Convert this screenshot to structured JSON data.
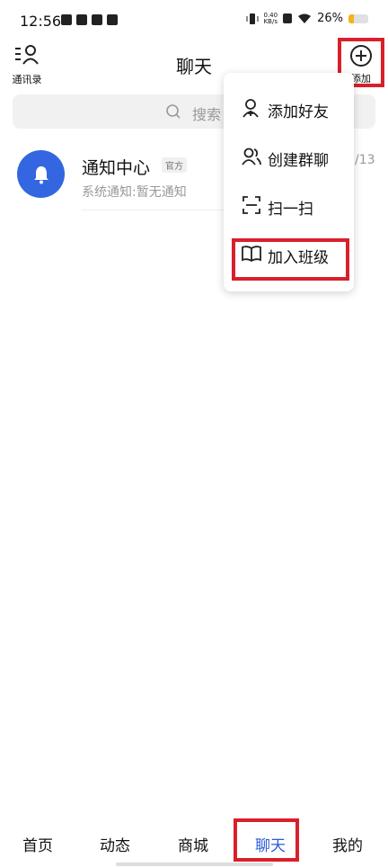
{
  "status_bar": {
    "time": "12:56",
    "net_speed_value": "0.40",
    "net_speed_unit": "KB/s",
    "battery_percent": "26%",
    "battery_level": 0.26
  },
  "header": {
    "contacts_label": "通讯录",
    "title": "聊天",
    "add_label": "添加"
  },
  "search": {
    "placeholder": "搜索"
  },
  "conversations": [
    {
      "name": "通知中心",
      "badge": "官方",
      "preview": "系统通知:暂无通知",
      "time": "/13"
    }
  ],
  "add_menu": {
    "items": [
      {
        "label": "添加好友",
        "icon": "add-friend-icon"
      },
      {
        "label": "创建群聊",
        "icon": "create-group-icon"
      },
      {
        "label": "扫一扫",
        "icon": "scan-icon"
      },
      {
        "label": "加入班级",
        "icon": "open-book-icon"
      }
    ]
  },
  "tabs": [
    "首页",
    "动态",
    "商城",
    "聊天",
    "我的"
  ],
  "active_tab": "聊天",
  "colors": {
    "accent_blue": "#2a5bd7",
    "avatar_blue": "#3366e0",
    "highlight_red": "#d9202a"
  }
}
